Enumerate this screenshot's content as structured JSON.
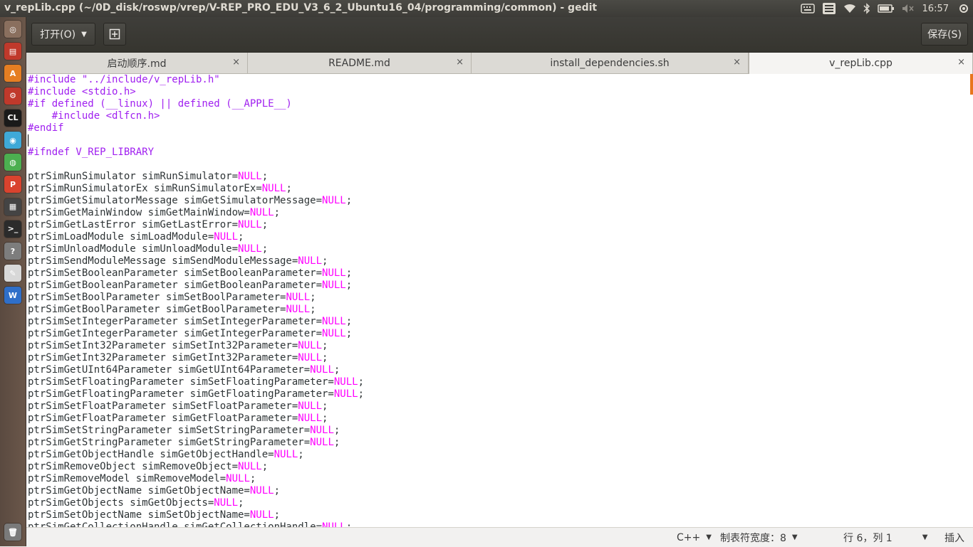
{
  "window": {
    "title": "v_repLib.cpp (~/0D_disk/roswp/vrep/V-REP_PRO_EDU_V3_6_2_Ubuntu16_04/programming/common) - gedit"
  },
  "panel": {
    "clock": "16:57",
    "indicators": [
      "keyboard-icon",
      "input-method-icon",
      "wifi-icon",
      "bluetooth-icon",
      "battery-icon",
      "volume-muted-icon"
    ]
  },
  "launcher": {
    "items": [
      {
        "name": "dash-icon",
        "color": "#8a6f5e",
        "glyph": "◎"
      },
      {
        "name": "files-icon",
        "color": "#c0392b",
        "glyph": "▤"
      },
      {
        "name": "software-center-icon",
        "color": "#e67e22",
        "glyph": "A"
      },
      {
        "name": "settings-icon",
        "color": "#c0392b",
        "glyph": "⚙"
      },
      {
        "name": "clion-icon",
        "color": "#1a1a1a",
        "glyph": "CL"
      },
      {
        "name": "wechat-icon",
        "color": "#3fa9d8",
        "glyph": "◉"
      },
      {
        "name": "chrome-icon",
        "color": "#4caf50",
        "glyph": "◍"
      },
      {
        "name": "wps-presentation-icon",
        "color": "#d9432e",
        "glyph": "P"
      },
      {
        "name": "video-icon",
        "color": "#444444",
        "glyph": "▦"
      },
      {
        "name": "terminal-icon",
        "color": "#2b2b2b",
        "glyph": ">_"
      },
      {
        "name": "unknown-app-icon",
        "color": "#7d7d7d",
        "glyph": "?"
      },
      {
        "name": "text-editor-icon",
        "color": "#d8d8d8",
        "glyph": "✎"
      },
      {
        "name": "wps-writer-icon",
        "color": "#2f6fc9",
        "glyph": "W"
      },
      {
        "name": "trash-icon",
        "color": "#7a7a7a",
        "glyph": "🗑"
      }
    ]
  },
  "header": {
    "open_label": "打开(O)",
    "new_tab_icon": "new-tab-icon",
    "save_label": "保存(S)"
  },
  "tabs": [
    {
      "label": "启动顺序.md",
      "active": false
    },
    {
      "label": "README.md",
      "active": false
    },
    {
      "label": "install_dependencies.sh",
      "active": false
    },
    {
      "label": "v_repLib.cpp",
      "active": true
    }
  ],
  "tab_close_glyph": "×",
  "editor": {
    "lines": [
      "#include \"../include/v_repLib.h\"",
      "#include <stdio.h>",
      "#if defined (__linux) || defined (__APPLE__)",
      "    #include <dlfcn.h>",
      "#endif",
      "",
      "#ifndef V_REP_LIBRARY",
      "",
      "ptrSimRunSimulator simRunSimulator=NULL;",
      "ptrSimRunSimulatorEx simRunSimulatorEx=NULL;",
      "ptrSimGetSimulatorMessage simGetSimulatorMessage=NULL;",
      "ptrSimGetMainWindow simGetMainWindow=NULL;",
      "ptrSimGetLastError simGetLastError=NULL;",
      "ptrSimLoadModule simLoadModule=NULL;",
      "ptrSimUnloadModule simUnloadModule=NULL;",
      "ptrSimSendModuleMessage simSendModuleMessage=NULL;",
      "ptrSimSetBooleanParameter simSetBooleanParameter=NULL;",
      "ptrSimGetBooleanParameter simGetBooleanParameter=NULL;",
      "ptrSimSetBoolParameter simSetBoolParameter=NULL;",
      "ptrSimGetBoolParameter simGetBoolParameter=NULL;",
      "ptrSimSetIntegerParameter simSetIntegerParameter=NULL;",
      "ptrSimGetIntegerParameter simGetIntegerParameter=NULL;",
      "ptrSimSetInt32Parameter simSetInt32Parameter=NULL;",
      "ptrSimGetInt32Parameter simGetInt32Parameter=NULL;",
      "ptrSimGetUInt64Parameter simGetUInt64Parameter=NULL;",
      "ptrSimSetFloatingParameter simSetFloatingParameter=NULL;",
      "ptrSimGetFloatingParameter simGetFloatingParameter=NULL;",
      "ptrSimSetFloatParameter simSetFloatParameter=NULL;",
      "ptrSimGetFloatParameter simGetFloatParameter=NULL;",
      "ptrSimSetStringParameter simSetStringParameter=NULL;",
      "ptrSimGetStringParameter simGetStringParameter=NULL;",
      "ptrSimGetObjectHandle simGetObjectHandle=NULL;",
      "ptrSimRemoveObject simRemoveObject=NULL;",
      "ptrSimRemoveModel simRemoveModel=NULL;",
      "ptrSimGetObjectName simGetObjectName=NULL;",
      "ptrSimGetObjects simGetObjects=NULL;",
      "ptrSimSetObjectName simSetObjectName=NULL;",
      "ptrSimGetCollectionHandle simGetCollectionHandle=NULL;"
    ],
    "colors": {
      "preprocessor": "#a020f0",
      "null_keyword": "#ff00ff",
      "text": "#2e3436"
    }
  },
  "statusbar": {
    "language": "C++",
    "tab_width": "制表符宽度：8",
    "position": "行 6，列 1",
    "mode": "插入"
  }
}
